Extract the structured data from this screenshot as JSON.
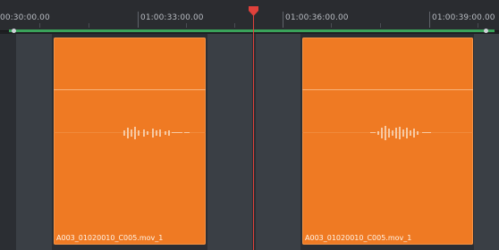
{
  "ruler": {
    "labels": [
      "00:30:00.00",
      "01:00:33:00.00",
      "01:00:36:00.00",
      "01:00:39:00.00"
    ]
  },
  "clips": [
    {
      "name": "A003_01020010_C005.mov_1"
    },
    {
      "name": "A003_01020010_C005.mov_1"
    }
  ],
  "colors": {
    "clip": "#ef7a23",
    "playhead": "#e0413b",
    "inout": "#3aa35a"
  }
}
